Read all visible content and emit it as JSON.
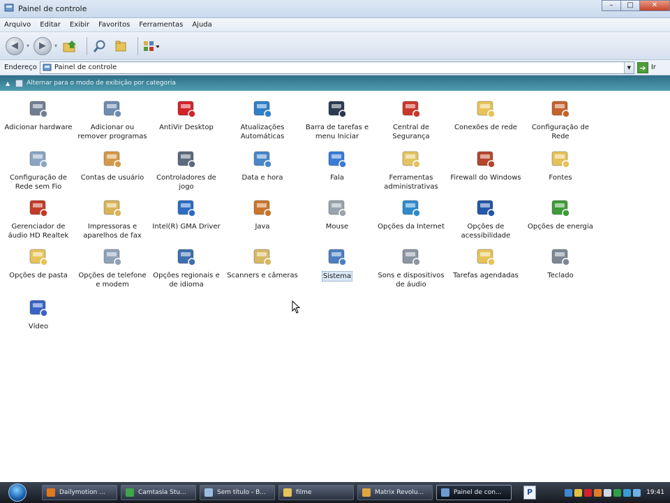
{
  "window": {
    "title": "Painel de controle",
    "controls": {
      "minimize": "–",
      "maximize": "□",
      "close": "✕"
    }
  },
  "menu": [
    "Arquivo",
    "Editar",
    "Exibir",
    "Favoritos",
    "Ferramentas",
    "Ajuda"
  ],
  "toolbar": {
    "icons": [
      "back-icon",
      "forward-icon",
      "up-folder-icon",
      "search-icon",
      "folders-icon",
      "views-icon"
    ]
  },
  "address": {
    "label": "Endereço",
    "value": "Painel de controle",
    "go_label": "Ir"
  },
  "taskpane": {
    "link": "Alternar para o modo de exibição por categoria"
  },
  "items": [
    {
      "label": "Adicionar hardware",
      "icon": "hardware-icon",
      "color": "#6f7f90"
    },
    {
      "label": "Adicionar ou remover programas",
      "icon": "programs-icon",
      "color": "#6d8db0"
    },
    {
      "label": "AntiVir Desktop",
      "icon": "antivir-icon",
      "color": "#d3222a"
    },
    {
      "label": "Atualizações Automáticas",
      "icon": "globe-update-icon",
      "color": "#2f7fc8"
    },
    {
      "label": "Barra de tarefas e menu Iniciar",
      "icon": "taskbar-icon",
      "color": "#2b3a4f"
    },
    {
      "label": "Central de Segurança",
      "icon": "shield-icon",
      "color": "#c9372c"
    },
    {
      "label": "Conexões de rede",
      "icon": "network-folder-icon",
      "color": "#e6c35a"
    },
    {
      "label": "Configuração de Rede",
      "icon": "home-network-icon",
      "color": "#c4632e"
    },
    {
      "label": "Configuração de Rede sem Fio",
      "icon": "wireless-icon",
      "color": "#8aa6c2"
    },
    {
      "label": "Contas de usuário",
      "icon": "users-icon",
      "color": "#d49a4a"
    },
    {
      "label": "Controladores de jogo",
      "icon": "gamepad-icon",
      "color": "#5c6a7d"
    },
    {
      "label": "Data e hora",
      "icon": "calendar-clock-icon",
      "color": "#4a86c8"
    },
    {
      "label": "Fala",
      "icon": "speech-icon",
      "color": "#3a7bd5"
    },
    {
      "label": "Ferramentas administrativas",
      "icon": "admin-tools-icon",
      "color": "#e2c462"
    },
    {
      "label": "Firewall do Windows",
      "icon": "firewall-icon",
      "color": "#b5452d"
    },
    {
      "label": "Fontes",
      "icon": "fonts-folder-icon",
      "color": "#e6c35a"
    },
    {
      "label": "Gerenciador de áudio HD Realtek",
      "icon": "speaker-icon",
      "color": "#c23b2a"
    },
    {
      "label": "Impressoras e aparelhos de fax",
      "icon": "printer-icon",
      "color": "#d9b55a"
    },
    {
      "label": "Intel(R) GMA Driver",
      "icon": "intel-icon",
      "color": "#2c6cc4"
    },
    {
      "label": "Java",
      "icon": "java-icon",
      "color": "#c9762c"
    },
    {
      "label": "Mouse",
      "icon": "mouse-icon",
      "color": "#9aa3ad"
    },
    {
      "label": "Opções da Internet",
      "icon": "internet-options-icon",
      "color": "#2f8acb"
    },
    {
      "label": "Opções de acessibilidade",
      "icon": "accessibility-icon",
      "color": "#2456a8"
    },
    {
      "label": "Opções de energia",
      "icon": "power-icon",
      "color": "#3f9a3a"
    },
    {
      "label": "Opções de pasta",
      "icon": "folder-options-icon",
      "color": "#e6c35a"
    },
    {
      "label": "Opções de telefone e modem",
      "icon": "phone-icon",
      "color": "#8fa3b8"
    },
    {
      "label": "Opções regionais e de idioma",
      "icon": "regional-icon",
      "color": "#3d6fb0"
    },
    {
      "label": "Scanners e câmeras",
      "icon": "scanner-icon",
      "color": "#d8b865"
    },
    {
      "label": "Sistema",
      "icon": "system-icon",
      "color": "#4b7fc0"
    },
    {
      "label": "Sons e dispositivos de áudio",
      "icon": "sound-icon",
      "color": "#8c96a2"
    },
    {
      "label": "Tarefas agendadas",
      "icon": "scheduled-tasks-icon",
      "color": "#e6c35a"
    },
    {
      "label": "Teclado",
      "icon": "keyboard-icon",
      "color": "#7d8794"
    },
    {
      "label": "Vídeo",
      "icon": "video-icon",
      "color": "#3a63c4"
    }
  ],
  "selected_item": "Sistema",
  "taskbar": {
    "tasks": [
      {
        "label": "Dailymotion ...",
        "icon": "firefox-icon",
        "color": "#e07a1f"
      },
      {
        "label": "Camtasia Stu...",
        "icon": "camtasia-icon",
        "color": "#3fa64a"
      },
      {
        "label": "Sem título - B...",
        "icon": "notepad-icon",
        "color": "#9cbde3"
      },
      {
        "label": "filme",
        "icon": "folder-icon",
        "color": "#e6c35a"
      },
      {
        "label": "Matrix Revolu...",
        "icon": "media-player-icon",
        "color": "#e0a640"
      },
      {
        "label": "Painel de con...",
        "icon": "control-panel-icon",
        "color": "#6d9bd1",
        "active": true
      }
    ],
    "quick_button": "P",
    "clock": "19:41",
    "tray_icons": [
      {
        "icon": "tray-network-icon",
        "color": "#3f88d1"
      },
      {
        "icon": "tray-shield-icon",
        "color": "#e2c13f"
      },
      {
        "icon": "tray-antivir-icon",
        "color": "#d3222a"
      },
      {
        "icon": "tray-update-icon",
        "color": "#e27c2b"
      },
      {
        "icon": "tray-volume-icon",
        "color": "#cfd8e3"
      },
      {
        "icon": "tray-security-icon",
        "color": "#2f9f4a"
      },
      {
        "icon": "tray-monitor-icon",
        "color": "#3a9bd5"
      },
      {
        "icon": "tray-display-icon",
        "color": "#6fb0e3"
      }
    ]
  }
}
